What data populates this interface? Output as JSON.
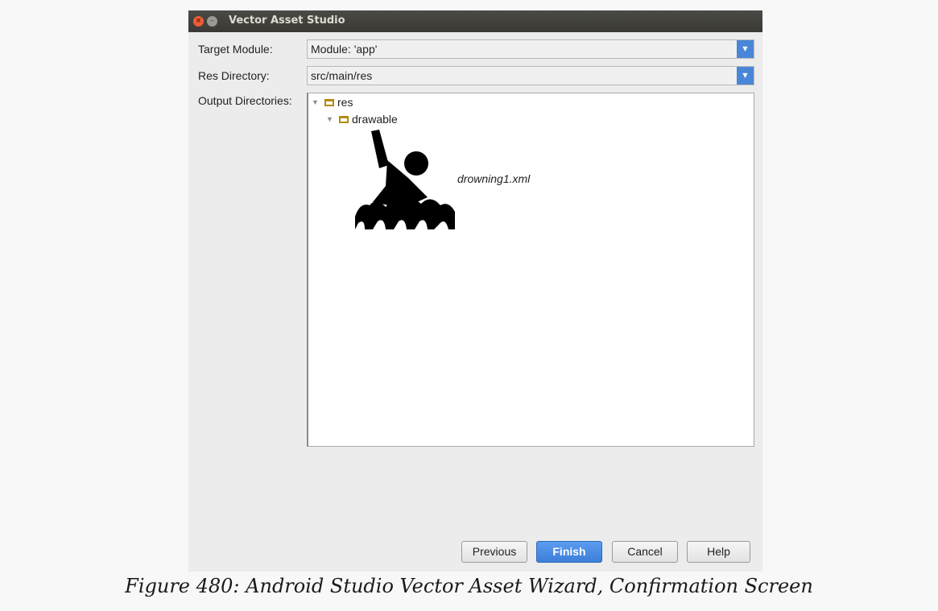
{
  "window": {
    "title": "Vector Asset Studio",
    "close_glyph": "×",
    "minimize_glyph": "–"
  },
  "form": {
    "target_module_label": "Target Module:",
    "target_module_value": "Module: 'app'",
    "res_directory_label": "Res Directory:",
    "res_directory_value": "src/main/res",
    "output_directories_label": "Output Directories:"
  },
  "tree": {
    "root_label": "res",
    "child_label": "drawable",
    "file_name": "drowning1.xml",
    "preview_icon": "drowning-person-icon"
  },
  "buttons": {
    "previous": "Previous",
    "finish": "Finish",
    "cancel": "Cancel",
    "help": "Help"
  },
  "caption": "Figure 480: Android Studio Vector Asset Wizard, Confirmation Screen",
  "colors": {
    "accent": "#4a86d8",
    "titlebar": "#3c3b37",
    "close": "#ed5d35",
    "folder": "#b38a0f"
  }
}
